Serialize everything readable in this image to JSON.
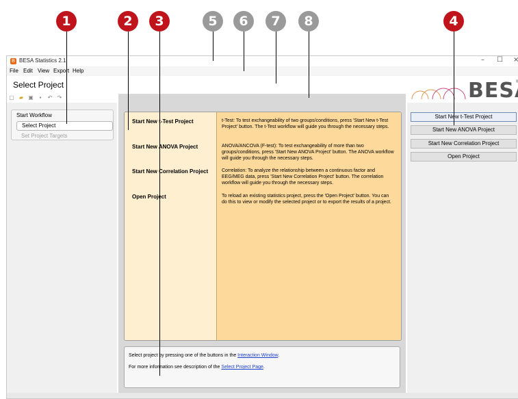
{
  "callouts": [
    "1",
    "2",
    "3",
    "4",
    "5",
    "6",
    "7",
    "8"
  ],
  "window": {
    "title": "BESA Statistics 2.1",
    "controls": {
      "minimize": "–",
      "maximize": "☐",
      "close": "×"
    }
  },
  "menu": [
    "File",
    "Edit",
    "View",
    "Export",
    "Help"
  ],
  "page_title": "Select Project",
  "toolbar_icons": [
    "new-file-icon",
    "open-folder-icon",
    "open-file-icon",
    "save-icon",
    "undo-icon",
    "redo-icon"
  ],
  "logo": {
    "text": "BESA",
    "mark": "®"
  },
  "workflow": {
    "header": "Start Workflow",
    "items": [
      {
        "label": "Select Project",
        "state": "selected"
      },
      {
        "label": "Set Project Targets",
        "state": "disabled"
      }
    ]
  },
  "projects": [
    {
      "label": "Start New t-Test Project",
      "description": "t-Test: To test exchangeability of two groups/conditions, press 'Start New t-Test Project' button. The t-Test workflow will guide you through the necessary steps."
    },
    {
      "label": "Start New ANOVA Project",
      "description": "ANOVA/ANCOVA (F-test): To test exchangeability of more than two groups/conditions, press 'Start New ANOVA Project' button. The ANOVA workflow will guide you through the necessary steps."
    },
    {
      "label": "Start New Correlation Project",
      "description": "Correlation: To analyze the relationship between a continuous factor and EEG/MEG data, press 'Start New Correlation Project' button. The correlation workflow will guide you through the necessary steps."
    },
    {
      "label": "Open Project",
      "description": "To reload an existing statistics project, press the 'Open Project' button. You can do this to view or modify the selected project or to export the results of a project."
    }
  ],
  "info": {
    "line1_prefix": "Select project by pressing one of the buttons in the ",
    "line1_link": "Interaction Window",
    "line1_suffix": ".",
    "line2_prefix": "For more information see description of the ",
    "line2_link": "Select Project Page",
    "line2_suffix": "."
  },
  "buttons": [
    "Start New t-Test Project",
    "Start New ANOVA Project",
    "Start New Correlation Project",
    "Open Project"
  ],
  "colors": {
    "callout_red": "#c0141c",
    "callout_gray": "#9a9a9a",
    "card_left": "#fdefd0",
    "card_right": "#fdd99b"
  }
}
